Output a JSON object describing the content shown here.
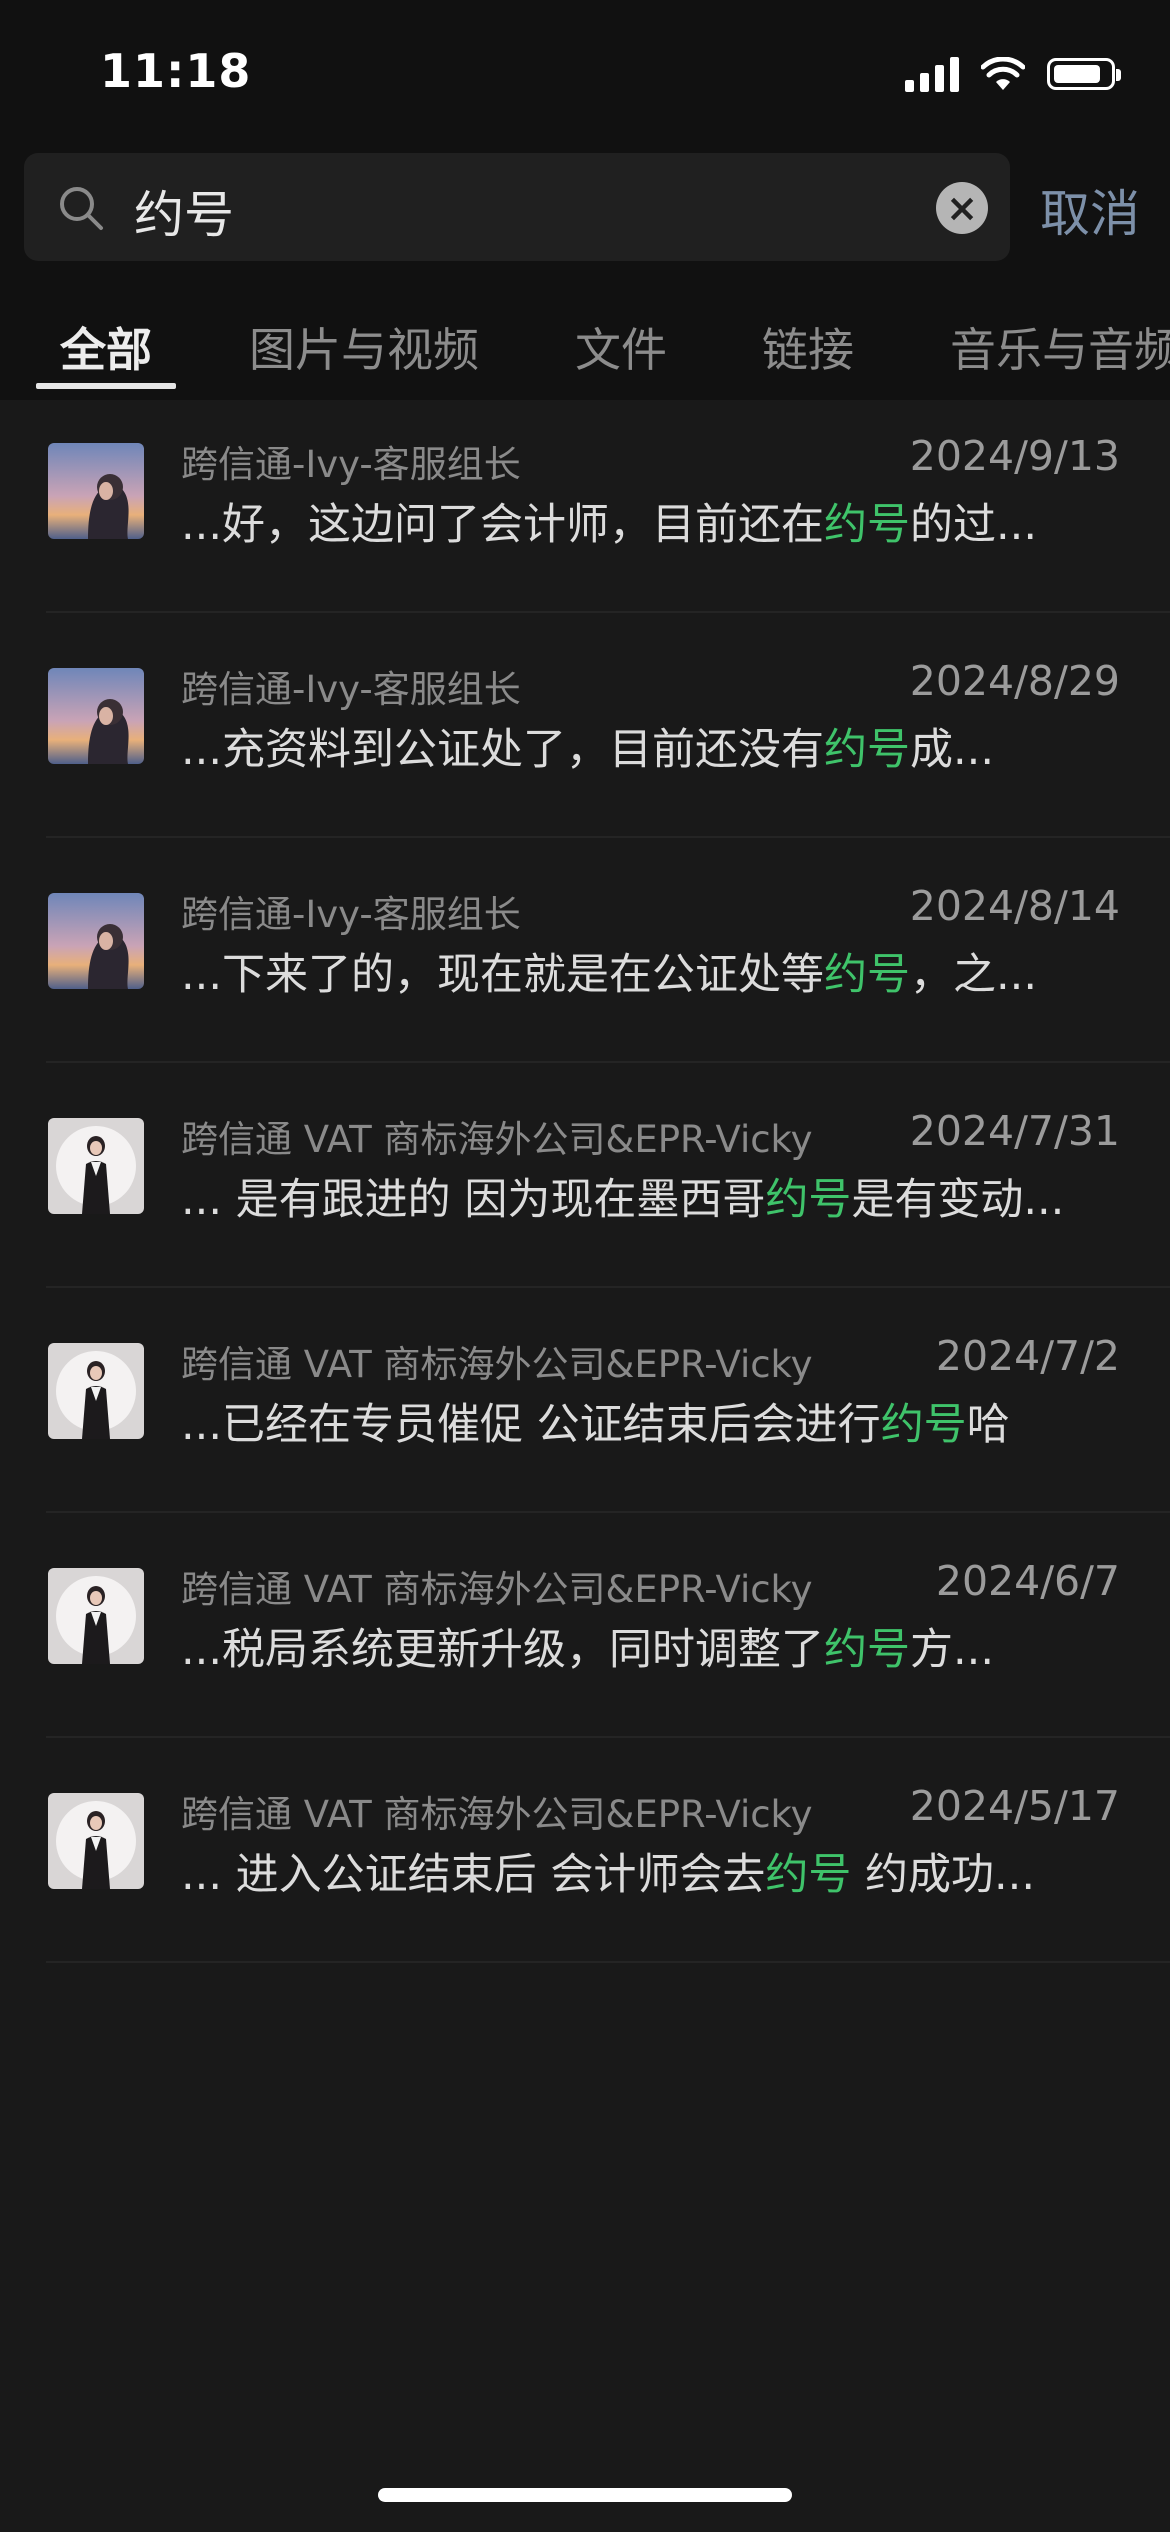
{
  "status_bar": {
    "time": "11:18",
    "battery_level": 0.85
  },
  "search": {
    "query": "约号",
    "cancel_label": "取消"
  },
  "tabs": [
    {
      "label": "全部",
      "active": true
    },
    {
      "label": "图片与视频",
      "active": false
    },
    {
      "label": "文件",
      "active": false
    },
    {
      "label": "链接",
      "active": false
    },
    {
      "label": "音乐与音频",
      "active": false
    }
  ],
  "results": [
    {
      "name": "跨信通-Ivy-客服组长",
      "date": "2024/9/13",
      "pre": "...好，这边问了会计师，目前还在",
      "match": "约号",
      "post": "的过...",
      "avatar": "ivy"
    },
    {
      "name": "跨信通-Ivy-客服组长",
      "date": "2024/8/29",
      "pre": "...充资料到公证处了，目前还没有",
      "match": "约号",
      "post": "成...",
      "avatar": "ivy"
    },
    {
      "name": "跨信通-Ivy-客服组长",
      "date": "2024/8/14",
      "pre": "...下来了的，现在就是在公证处等",
      "match": "约号",
      "post": "，之...",
      "avatar": "ivy"
    },
    {
      "name": "跨信通 VAT 商标海外公司&EPR-Vicky",
      "date": "2024/7/31",
      "pre": "... 是有跟进的 因为现在墨西哥",
      "match": "约号",
      "post": "是有变动...",
      "avatar": "vicky"
    },
    {
      "name": "跨信通 VAT 商标海外公司&EPR-Vicky",
      "date": "2024/7/2",
      "pre": "...已经在专员催促 公证结束后会进行",
      "match": "约号",
      "post": "哈",
      "avatar": "vicky"
    },
    {
      "name": "跨信通 VAT 商标海外公司&EPR-Vicky",
      "date": "2024/6/7",
      "pre": "...税局系统更新升级，同时调整了",
      "match": "约号",
      "post": "方...",
      "avatar": "vicky"
    },
    {
      "name": "跨信通 VAT 商标海外公司&EPR-Vicky",
      "date": "2024/5/17",
      "pre": "... 进入公证结束后 会计师会去",
      "match": "约号",
      "post": "  约成功...",
      "avatar": "vicky"
    }
  ]
}
